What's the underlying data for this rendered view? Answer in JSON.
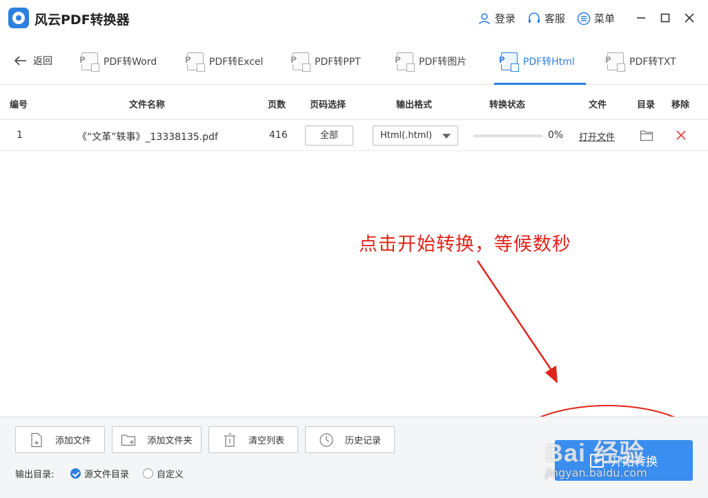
{
  "app": {
    "title": "风云PDF转换器"
  },
  "titlebar": {
    "login": "登录",
    "service": "客服",
    "menu": "菜单"
  },
  "tabs": {
    "back": "返回",
    "items": [
      {
        "label": "PDF转Word",
        "icon": "W"
      },
      {
        "label": "PDF转Excel",
        "icon": "E"
      },
      {
        "label": "PDF转PPT",
        "icon": "P"
      },
      {
        "label": "PDF转图片",
        "icon": "I"
      },
      {
        "label": "PDF转Html",
        "icon": "H",
        "active": true
      },
      {
        "label": "PDF转TXT",
        "icon": "T"
      }
    ]
  },
  "table": {
    "headers": {
      "index": "编号",
      "filename": "文件名称",
      "pages": "页数",
      "page_select": "页码选择",
      "format": "输出格式",
      "status": "转换状态",
      "file": "文件",
      "dir": "目录",
      "remove": "移除"
    },
    "rows": [
      {
        "index": "1",
        "filename": "《“文革”轶事》_13338135.pdf",
        "pages": "416",
        "page_select": "全部",
        "format": "Html(.html)",
        "progress": 0,
        "percent": "0%",
        "open_file": "打开文件"
      }
    ]
  },
  "annotation": {
    "text": "点击开始转换，等候数秒",
    "color": "#e2231a"
  },
  "bottom": {
    "add_file": "添加文件",
    "add_folder": "添加文件夹",
    "clear_list": "清空列表",
    "history": "历史记录",
    "output_dir_label": "输出目录:",
    "option_source": "源文件目录",
    "option_custom": "自定义",
    "start": "开始转换"
  },
  "watermark": {
    "line1": "Bai 经验",
    "line2": "jingyan.baidu.com"
  },
  "colors": {
    "accent": "#2d7fe0",
    "annotation": "#e2231a"
  }
}
